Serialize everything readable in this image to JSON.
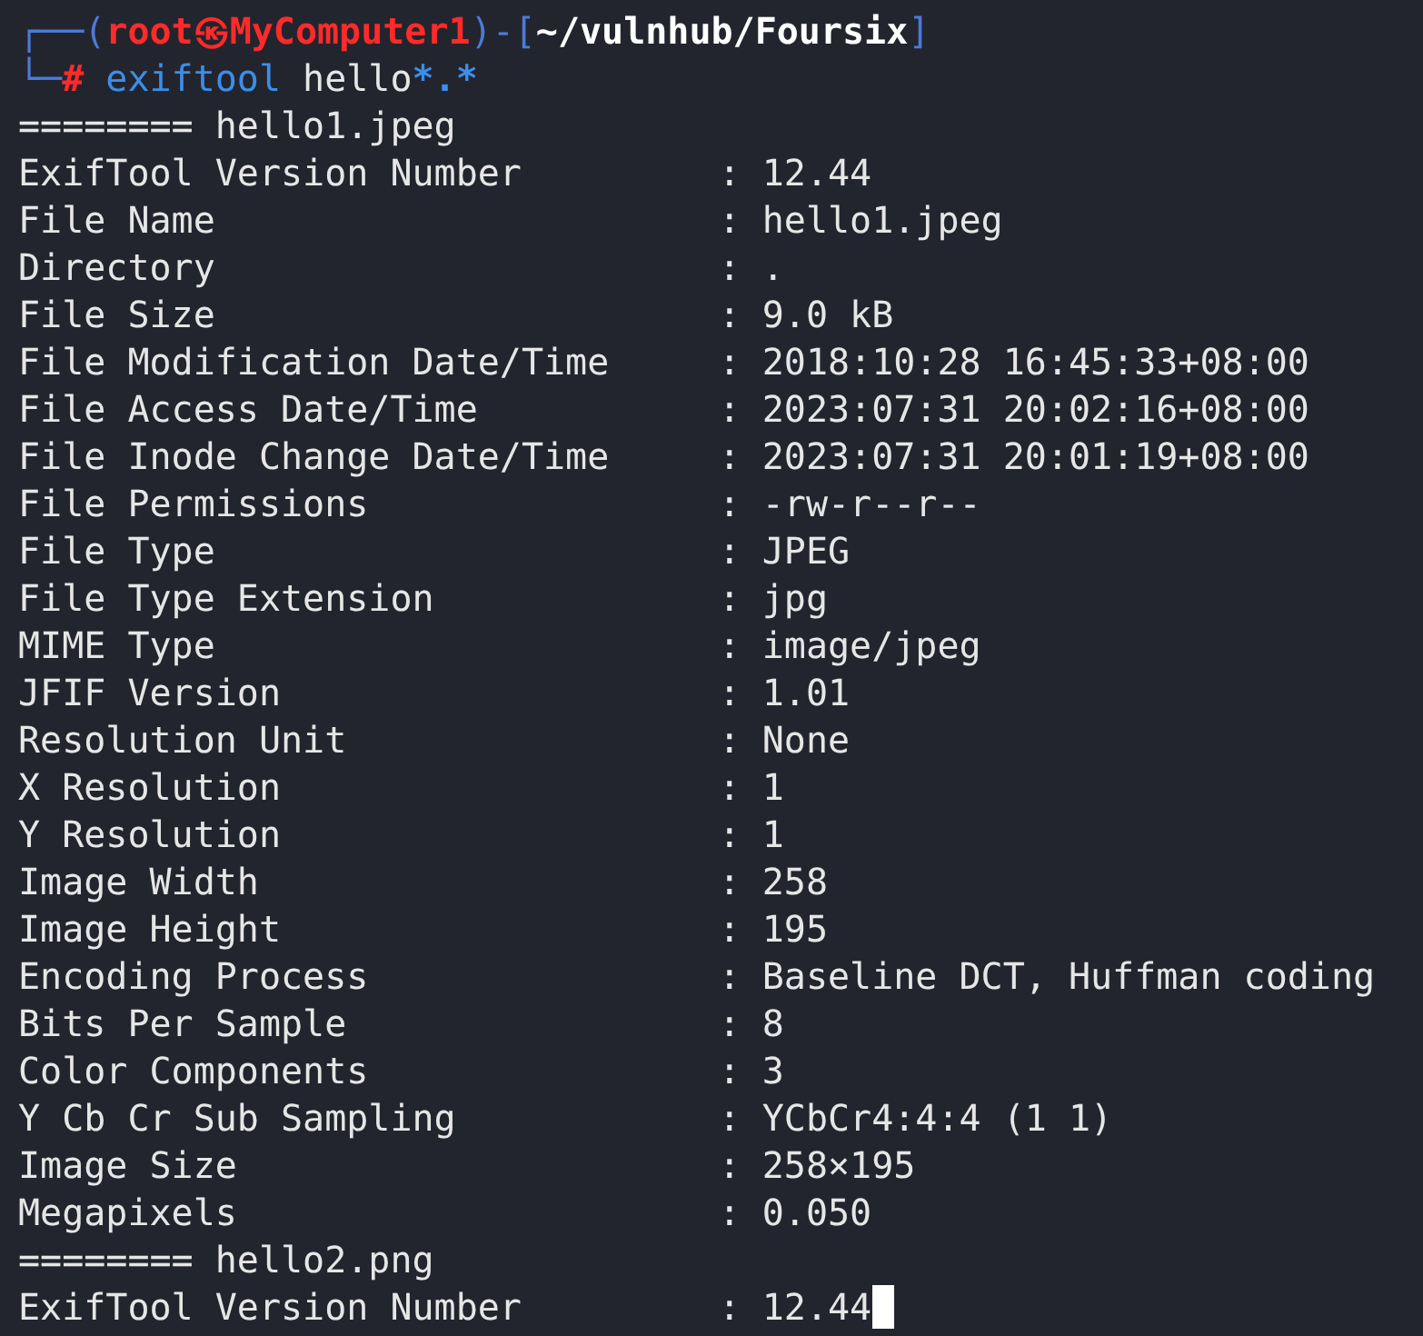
{
  "prompt": {
    "corner_top": "┌──(",
    "user_host": "root㉿MyComputer1",
    "sep": ")-[",
    "path": "~/vulnhub/Foursix",
    "close": "]",
    "corner_bottom": "└─",
    "symbol": "#",
    "command": "exiftool",
    "argument": "hello",
    "glob": "*.*"
  },
  "sections": [
    {
      "rule": "========",
      "filename": "hello1.jpeg",
      "rows": [
        {
          "tag": "ExifTool Version Number",
          "separator": ":",
          "value": "12.44"
        },
        {
          "tag": "File Name",
          "separator": ":",
          "value": "hello1.jpeg"
        },
        {
          "tag": "Directory",
          "separator": ":",
          "value": "."
        },
        {
          "tag": "File Size",
          "separator": ":",
          "value": "9.0 kB"
        },
        {
          "tag": "File Modification Date/Time",
          "separator": ":",
          "value": "2018:10:28 16:45:33+08:00"
        },
        {
          "tag": "File Access Date/Time",
          "separator": ":",
          "value": "2023:07:31 20:02:16+08:00"
        },
        {
          "tag": "File Inode Change Date/Time",
          "separator": ":",
          "value": "2023:07:31 20:01:19+08:00"
        },
        {
          "tag": "File Permissions",
          "separator": ":",
          "value": "-rw-r--r--"
        },
        {
          "tag": "File Type",
          "separator": ":",
          "value": "JPEG"
        },
        {
          "tag": "File Type Extension",
          "separator": ":",
          "value": "jpg"
        },
        {
          "tag": "MIME Type",
          "separator": ":",
          "value": "image/jpeg"
        },
        {
          "tag": "JFIF Version",
          "separator": ":",
          "value": "1.01"
        },
        {
          "tag": "Resolution Unit",
          "separator": ":",
          "value": "None"
        },
        {
          "tag": "X Resolution",
          "separator": ":",
          "value": "1"
        },
        {
          "tag": "Y Resolution",
          "separator": ":",
          "value": "1"
        },
        {
          "tag": "Image Width",
          "separator": ":",
          "value": "258"
        },
        {
          "tag": "Image Height",
          "separator": ":",
          "value": "195"
        },
        {
          "tag": "Encoding Process",
          "separator": ":",
          "value": "Baseline DCT, Huffman coding"
        },
        {
          "tag": "Bits Per Sample",
          "separator": ":",
          "value": "8"
        },
        {
          "tag": "Color Components",
          "separator": ":",
          "value": "3"
        },
        {
          "tag": "Y Cb Cr Sub Sampling",
          "separator": ":",
          "value": "YCbCr4:4:4 (1 1)"
        },
        {
          "tag": "Image Size",
          "separator": ":",
          "value": "258×195"
        },
        {
          "tag": "Megapixels",
          "separator": ":",
          "value": "0.050"
        }
      ]
    },
    {
      "rule": "========",
      "filename": "hello2.png",
      "rows": [
        {
          "tag": "ExifTool Version Number",
          "separator": ":",
          "value": "12.44"
        }
      ]
    }
  ],
  "cursor": {
    "visible": true
  }
}
